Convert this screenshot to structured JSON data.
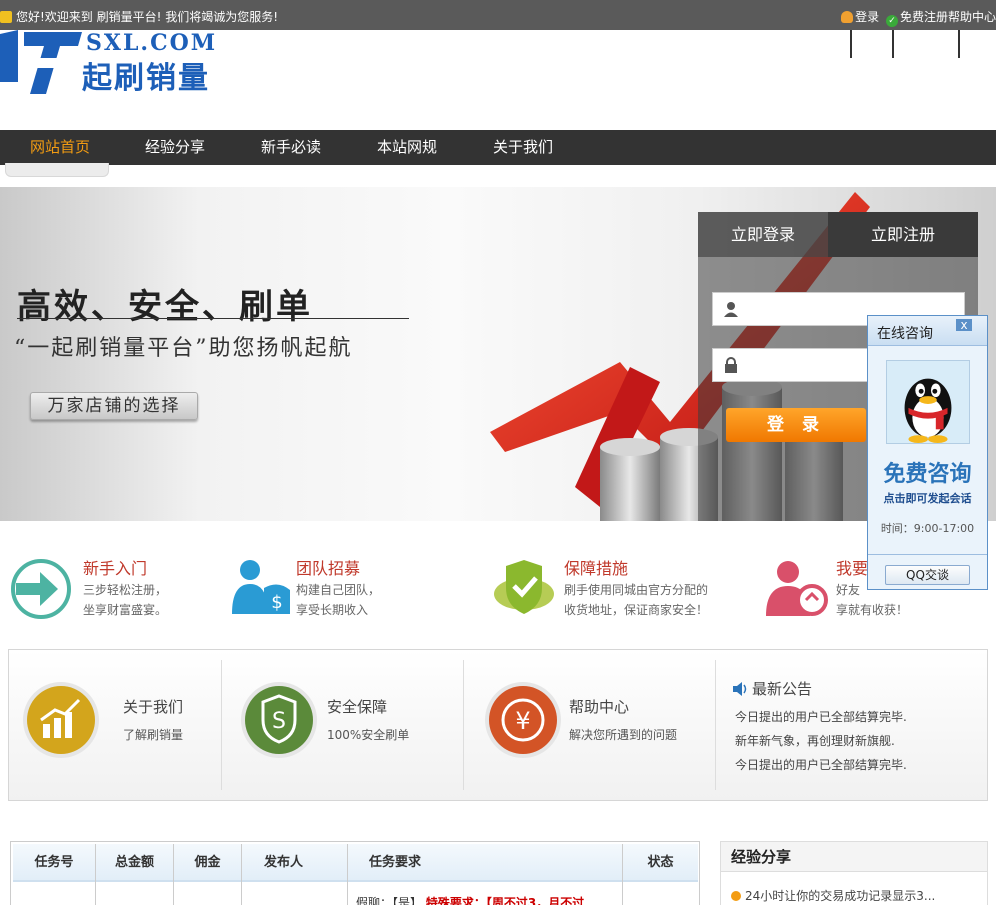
{
  "topbar": {
    "welcome": "您好!欢迎来到  刷销量平台! 我们将竭诚为您服务!",
    "login": "登录",
    "register": "免费注册",
    "help": "帮助中心"
  },
  "logo": {
    "number": "17",
    "domain": "SXL.COM",
    "name": "起刷销量"
  },
  "nav": {
    "items": [
      {
        "label": "网站首页",
        "active": true
      },
      {
        "label": "经验分享",
        "active": false
      },
      {
        "label": "新手必读",
        "active": false
      },
      {
        "label": "本站网规",
        "active": false
      },
      {
        "label": "关于我们",
        "active": false
      }
    ]
  },
  "banner": {
    "title": "高效、安全、刷单",
    "slogan": "“一起刷销量平台”助您扬帆起航",
    "choice_button": "万家店铺的选择"
  },
  "login_panel": {
    "tab_login": "立即登录",
    "tab_register": "立即注册",
    "username_placeholder": "",
    "password_placeholder": "",
    "submit": "登 录"
  },
  "features": [
    {
      "title": "新手入门",
      "desc1": "三步轻松注册，",
      "desc2": "坐享财富盛宴。",
      "color": "#4db3a2"
    },
    {
      "title": "团队招募",
      "desc1": "构建自己团队，",
      "desc2": "享受长期收入",
      "color": "#2a9bd4"
    },
    {
      "title": "保障措施",
      "desc1": "刷手使用同城由官方分配的",
      "desc2": "收货地址，保证商家安全！",
      "color": "#8bb82e"
    },
    {
      "title": "我要",
      "desc1": "好友",
      "desc2": "享就有收获！",
      "color": "#d9506a"
    }
  ],
  "info": {
    "items": [
      {
        "title": "关于我们",
        "desc": "了解刷销量",
        "icon": "chart-icon",
        "color": "#d3a51c"
      },
      {
        "title": "安全保障",
        "desc": "100%安全刷单",
        "icon": "shield-s-icon",
        "color": "#5b8a3a"
      },
      {
        "title": "帮助中心",
        "desc": "解决您所遇到的问题",
        "icon": "yen-icon",
        "color": "#d35426"
      }
    ],
    "notice_title": "最新公告",
    "notices": [
      "今日提出的用户已全部结算完毕.",
      "新年新气象，再创理财新旗舰.",
      "今日提出的用户已全部结算完毕."
    ]
  },
  "tasks": {
    "headers": [
      "任务号",
      "总金额",
      "佣金",
      "发布人",
      "任务要求",
      "状态"
    ],
    "first_row_text": "假聊：【是】",
    "first_row_special": "特殊要求：【周不过3，月不过"
  },
  "experience": {
    "title": "经验分享",
    "items": [
      "24小时让你的交易成功记录显示3..."
    ]
  },
  "qq_float": {
    "header": "在线咨询",
    "close": "x",
    "free": "免费咨询",
    "click": "点击即可发起会话",
    "time": "时间：9:00-17:00",
    "button": "QQ交谈"
  }
}
